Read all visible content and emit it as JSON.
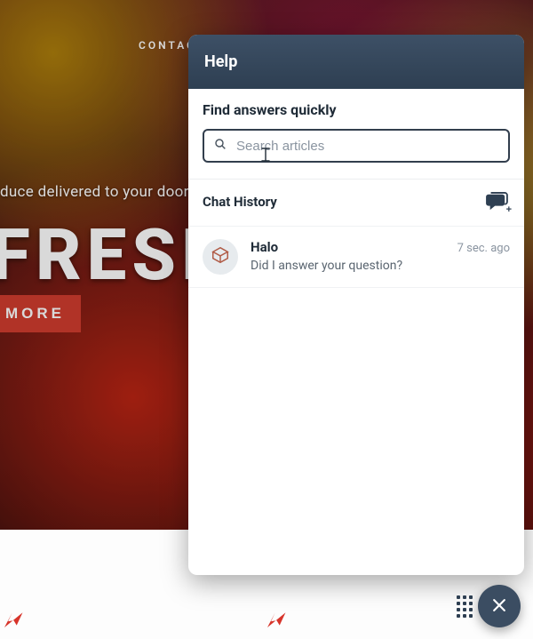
{
  "nav": {
    "contact": "CONTACT"
  },
  "hero": {
    "tagline_fragment": "duce delivered to your doorstep",
    "big_word": "FRESH",
    "cta_fragment": "MORE"
  },
  "panel": {
    "title": "Help",
    "find_title": "Find answers quickly",
    "search_placeholder": "Search articles",
    "history_title": "Chat History"
  },
  "chats": [
    {
      "name": "Halo",
      "snippet": "Did I answer your question?",
      "time": "7 sec. ago"
    }
  ],
  "icons": {
    "search": "search-icon",
    "new_chat": "new-chat-icon",
    "close": "close-icon",
    "drag": "drag-handle-icon",
    "plane": "airplane-icon",
    "avatar": "bot-avatar-icon"
  }
}
